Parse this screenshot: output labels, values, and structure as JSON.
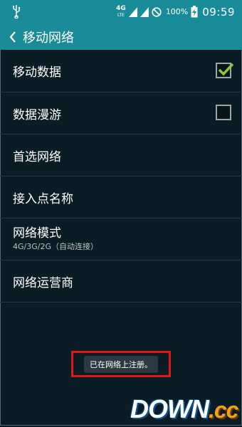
{
  "status_bar": {
    "network_type": "4G",
    "network_sub": "LTE",
    "battery_percent": "100%",
    "time": "09:59",
    "icons": [
      "usb-icon",
      "signal-icon",
      "signal-icon",
      "do-not-disturb-icon",
      "battery-charging-icon"
    ]
  },
  "header": {
    "title": "移动网络",
    "back_icon": "chevron-left-icon"
  },
  "settings": {
    "items": [
      {
        "label": "移动数据",
        "checked": true
      },
      {
        "label": "数据漫游",
        "checked": false
      },
      {
        "label": "首选网络"
      },
      {
        "label": "接入点名称"
      },
      {
        "label": "网络模式",
        "sublabel": "4G/3G/2G（自动连接）"
      },
      {
        "label": "网络运营商"
      }
    ]
  },
  "toast": {
    "text": "已在网络上注册。"
  },
  "colors": {
    "accent": "#1a8c99",
    "background": "#0b1d24",
    "check": "#8bc43f",
    "highlight_box": "#e01717"
  },
  "watermark": {
    "main": "DOWN",
    "suffix": ".cc"
  }
}
